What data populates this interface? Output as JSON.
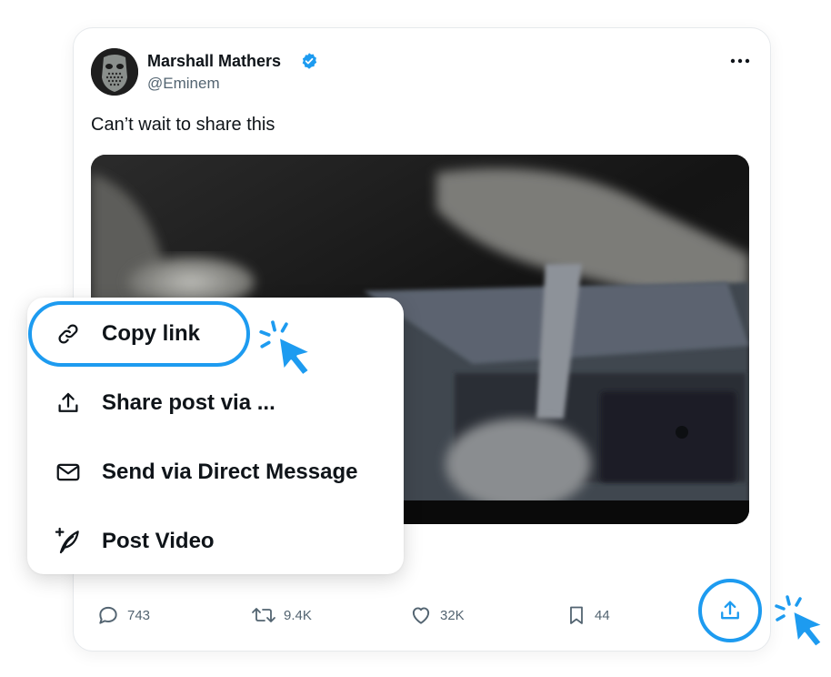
{
  "colors": {
    "accent": "#1d9bf0",
    "text": "#0f1419",
    "muted": "#536471"
  },
  "user": {
    "name": "Marshall Mathers",
    "handle": "@Eminem",
    "verified_icon": "verified-badge-icon"
  },
  "post": {
    "text": "Can’t wait to share this",
    "media": "video-thumbnail"
  },
  "actions": {
    "replies": "743",
    "reposts": "9.4K",
    "likes": "32K",
    "bookmarks": "44",
    "share_icon": "share-icon"
  },
  "share_menu": {
    "items": [
      {
        "label": "Copy link",
        "icon": "link-icon"
      },
      {
        "label": "Share post via ...",
        "icon": "share-icon"
      },
      {
        "label": "Send via Direct Message",
        "icon": "envelope-icon"
      },
      {
        "label": "Post Video",
        "icon": "compose-icon"
      }
    ]
  }
}
